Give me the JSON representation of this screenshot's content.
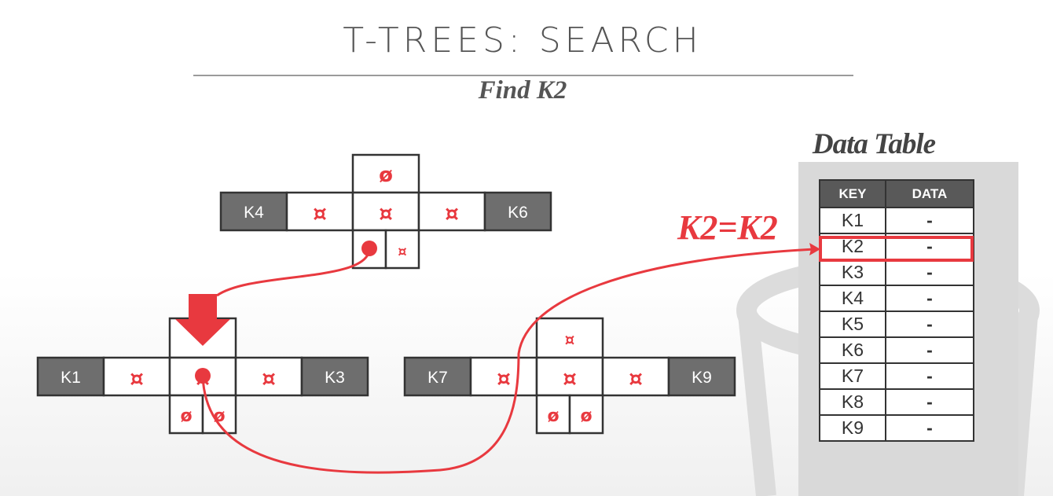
{
  "slide": {
    "title": "T-TREES: SEARCH",
    "subtitle": "Find K2"
  },
  "symbols": {
    "pointer": "¤",
    "null": "ø"
  },
  "nodes": {
    "root": {
      "left": "K4",
      "right": "K6"
    },
    "left_child": {
      "left": "K1",
      "right": "K3"
    },
    "right_child": {
      "left": "K7",
      "right": "K9"
    }
  },
  "match_label": "K2=K2",
  "data_table": {
    "title": "Data Table",
    "headers": [
      "KEY",
      "DATA"
    ],
    "rows": [
      {
        "key": "K1",
        "data": "-"
      },
      {
        "key": "K2",
        "data": "-"
      },
      {
        "key": "K3",
        "data": "-"
      },
      {
        "key": "K4",
        "data": "-"
      },
      {
        "key": "K5",
        "data": "-"
      },
      {
        "key": "K6",
        "data": "-"
      },
      {
        "key": "K7",
        "data": "-"
      },
      {
        "key": "K8",
        "data": "-"
      },
      {
        "key": "K9",
        "data": "-"
      }
    ],
    "highlighted_key": "K2"
  },
  "colors": {
    "accent": "#e8393f",
    "key_cell": "#6e6e6e",
    "border": "#333333"
  }
}
